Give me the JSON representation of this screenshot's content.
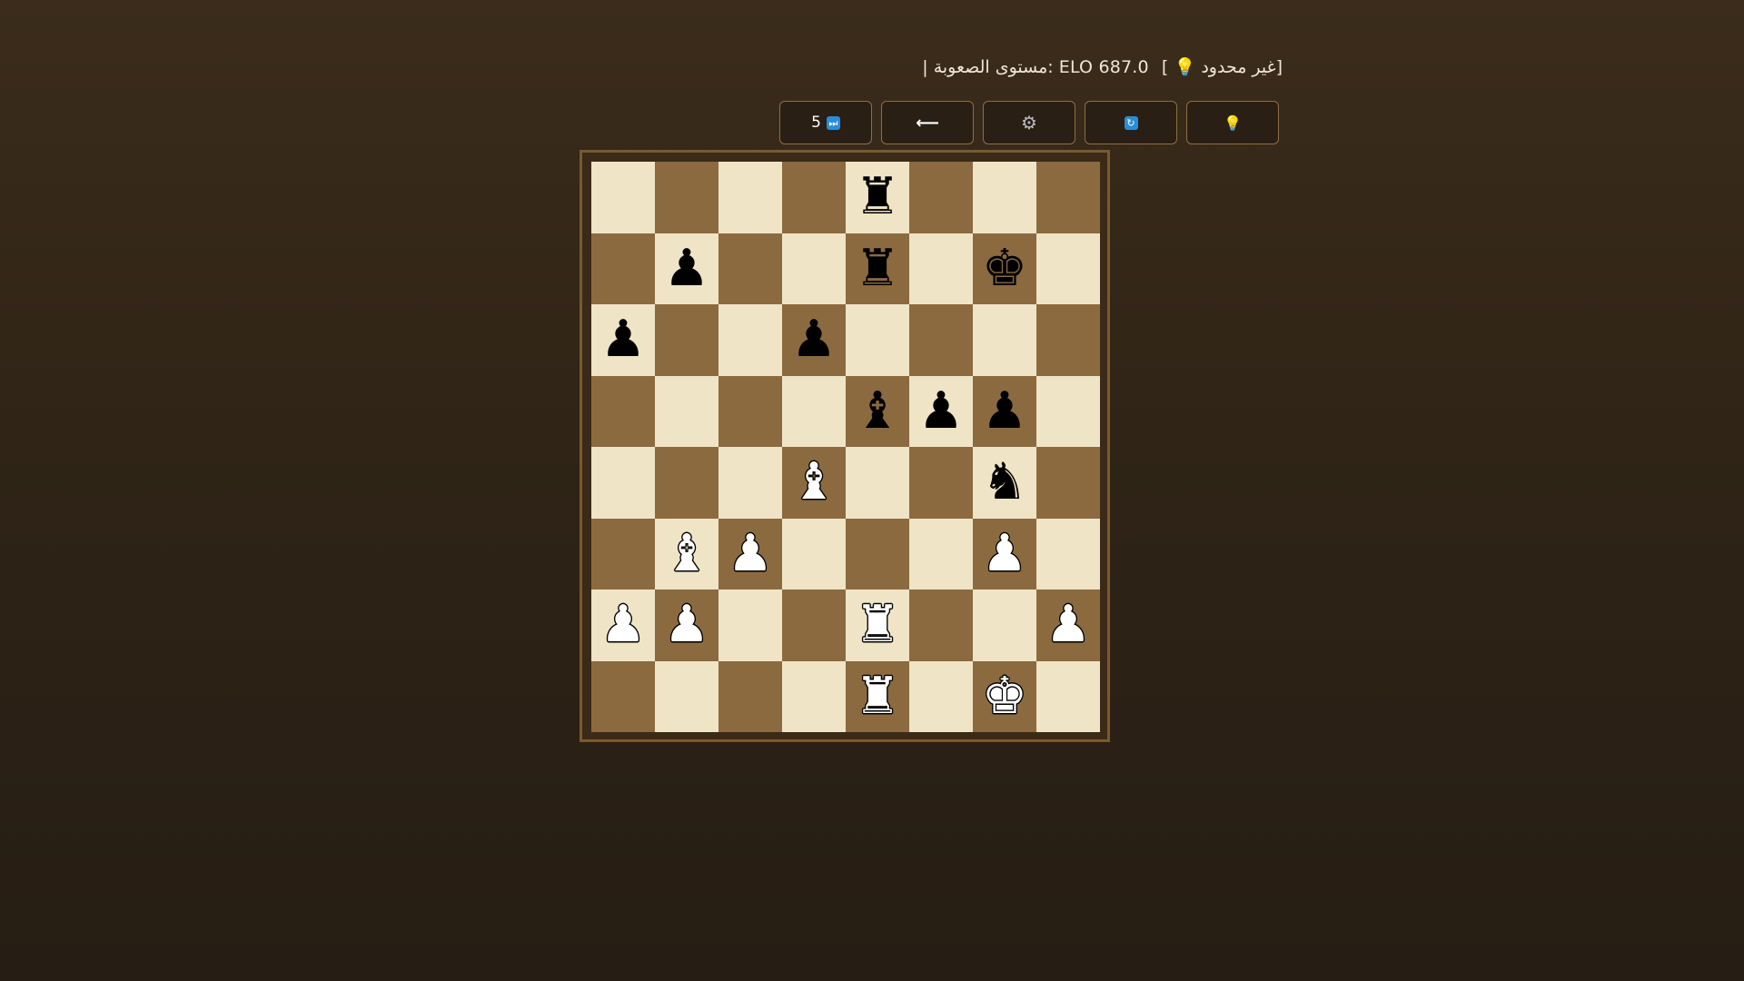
{
  "status": {
    "difficulty_label": "| مستوى الصعوبة: ELO 687.0",
    "hints_prefix": "[",
    "hint_icon": "lightbulb-icon",
    "hints_value": "غير محدود]"
  },
  "toolbar": {
    "hint_icon": "lightbulb-icon",
    "reset_icon": "refresh-icon",
    "settings_icon": "gear-icon",
    "back_icon": "left-arrow-icon",
    "skip_icon": "fast-forward-icon",
    "skip_count": "5"
  },
  "board": {
    "light_color": "#f0e4c6",
    "dark_color": "#8c6a3f",
    "ranks": [
      [
        "",
        "",
        "",
        "",
        "r",
        "",
        "",
        ""
      ],
      [
        "",
        "p",
        "",
        "",
        "r",
        "",
        "k",
        ""
      ],
      [
        "p",
        "",
        "",
        "p",
        "",
        "",
        "",
        ""
      ],
      [
        "",
        "",
        "",
        "",
        "b",
        "p",
        "p",
        ""
      ],
      [
        "",
        "",
        "",
        "B",
        "",
        "",
        "n",
        ""
      ],
      [
        "",
        "B",
        "P",
        "",
        "",
        "",
        "P",
        ""
      ],
      [
        "P",
        "P",
        "",
        "",
        "R",
        "",
        "",
        "P"
      ],
      [
        "",
        "",
        "",
        "",
        "R",
        "",
        "K",
        ""
      ]
    ]
  }
}
